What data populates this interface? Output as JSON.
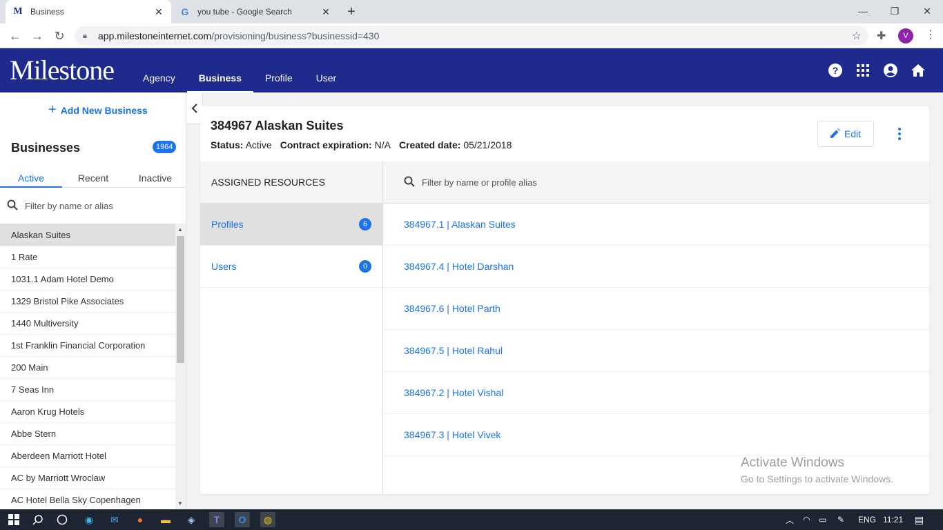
{
  "browser": {
    "tabs": [
      {
        "title": "Business",
        "favicon": "M"
      },
      {
        "title": "you tube - Google Search",
        "favicon": "G"
      }
    ],
    "url_host": "app.milestoneinternet.com",
    "url_path": "/provisioning/business?businessid=430",
    "profile_initial": "V"
  },
  "app": {
    "logo": "Milestone",
    "nav": [
      "Agency",
      "Business",
      "Profile",
      "User"
    ],
    "active_nav": "Business"
  },
  "sidebar": {
    "add_label": "Add New Business",
    "heading": "Businesses",
    "count": "1964",
    "tabs": [
      "Active",
      "Recent",
      "Inactive"
    ],
    "search_placeholder": "Filter by name or alias",
    "items": [
      "Alaskan Suites",
      "1 Rate",
      "1031.1 Adam Hotel Demo",
      "1329 Bristol Pike Associates",
      "1440 Multiversity",
      "1st Franklin Financial Corporation",
      "200 Main",
      "7 Seas Inn",
      "Aaron Krug Hotels",
      "Abbe Stern",
      "Aberdeen Marriott Hotel",
      "AC by Marriott Wroclaw",
      "AC Hotel Bella Sky Copenhagen"
    ]
  },
  "business": {
    "title": "384967 Alaskan Suites",
    "status_label": "Status:",
    "status_value": "Active",
    "contract_label": "Contract expiration:",
    "contract_value": "N/A",
    "created_label": "Created date:",
    "created_value": "05/21/2018",
    "edit_label": "Edit"
  },
  "resources": {
    "heading": "ASSIGNED RESOURCES",
    "items": [
      {
        "label": "Profiles",
        "count": "6"
      },
      {
        "label": "Users",
        "count": "0"
      }
    ],
    "search_placeholder": "Filter by name or profile alias",
    "profiles": [
      "384967.1 | Alaskan Suites",
      "384967.4 | Hotel Darshan",
      "384967.6 | Hotel Parth",
      "384967.5 | Hotel Rahul",
      "384967.2 | Hotel Vishal",
      "384967.3 | Hotel Vivek"
    ]
  },
  "watermark": {
    "line1": "Activate Windows",
    "line2": "Go to Settings to activate Windows."
  },
  "taskbar": {
    "lang": "ENG",
    "time": "11:21"
  },
  "colors": {
    "brand": "#1e2a8c",
    "accent": "#1a73e8"
  }
}
